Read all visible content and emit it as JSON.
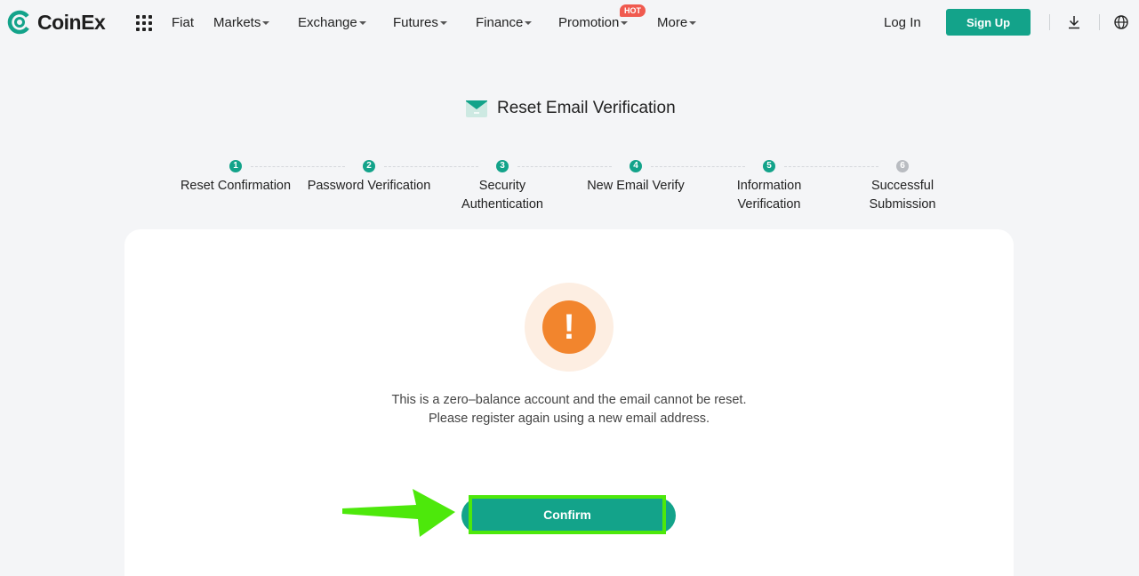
{
  "brand": {
    "name": "CoinEx",
    "color": "#13a38a"
  },
  "nav": [
    {
      "label": "Fiat",
      "dropdown": false
    },
    {
      "label": "Markets",
      "dropdown": true
    },
    {
      "label": "Exchange",
      "dropdown": true
    },
    {
      "label": "Futures",
      "dropdown": true
    },
    {
      "label": "Finance",
      "dropdown": true
    },
    {
      "label": "Promotion",
      "dropdown": true
    },
    {
      "label": "More",
      "dropdown": true
    }
  ],
  "badges": {
    "promotion": "HOT"
  },
  "header": {
    "login_label": "Log In",
    "signup_label": "Sign Up",
    "icons": [
      "apps-grid-icon",
      "download-icon",
      "globe-icon"
    ]
  },
  "page": {
    "title": "Reset Email Verification"
  },
  "steps": [
    {
      "number": "1",
      "line1": "Reset Confirmation",
      "line2": "",
      "done": true
    },
    {
      "number": "2",
      "line1": "Password Verification",
      "line2": "",
      "done": true
    },
    {
      "number": "3",
      "line1": "Security",
      "line2": "Authentication",
      "done": true
    },
    {
      "number": "4",
      "line1": "New Email Verify",
      "line2": "",
      "done": true
    },
    {
      "number": "5",
      "line1": "Information",
      "line2": "Verification",
      "done": true
    },
    {
      "number": "6",
      "line1": "Successful",
      "line2": "Submission",
      "done": false
    }
  ],
  "dialog": {
    "icon": "warning-icon",
    "message_line1": "This is a zero–balance account and the email cannot be reset.",
    "message_line2": "Please register again using a new email address.",
    "confirm_label": "Confirm"
  },
  "colors": {
    "warning": "#f2852d",
    "highlight": "#4de80b"
  }
}
